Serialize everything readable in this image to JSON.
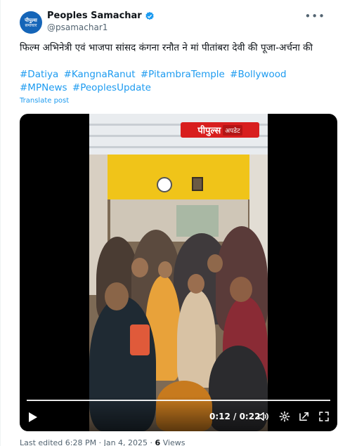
{
  "account": {
    "display_name": "Peoples Samachar",
    "handle": "@psamachar1",
    "avatar_line1": "पीपुल्स",
    "avatar_line2": "समाचार",
    "verified_color": "#1d9bf0"
  },
  "tweet": {
    "text": "फिल्म अभिनेत्री एवं भाजपा सांसद कंगना रनौत ने मां पीतांबरा देवी की पूजा-अर्चना की",
    "hashtags": [
      "#Datiya",
      "#KangnaRanut",
      "#PitambraTemple",
      "#Bollywood",
      "#MPNews",
      "#PeoplesUpdate"
    ],
    "translate_label": "Translate post"
  },
  "video": {
    "watermark_main": "पीपुल्स",
    "watermark_sub": "अपडेट",
    "time_display": "0:12 / 0:22",
    "progress": 1.0,
    "icons": [
      "play-icon",
      "volume-icon",
      "settings-icon",
      "pip-icon",
      "fullscreen-icon"
    ]
  },
  "meta": {
    "edited_text": "Last edited 6:28 PM · Jan 4, 2025 ·",
    "views_count": "6",
    "views_label": "Views"
  },
  "colors": {
    "link": "#1d9bf0",
    "secondary_text": "#536471",
    "brand_red": "#d81e1e"
  }
}
